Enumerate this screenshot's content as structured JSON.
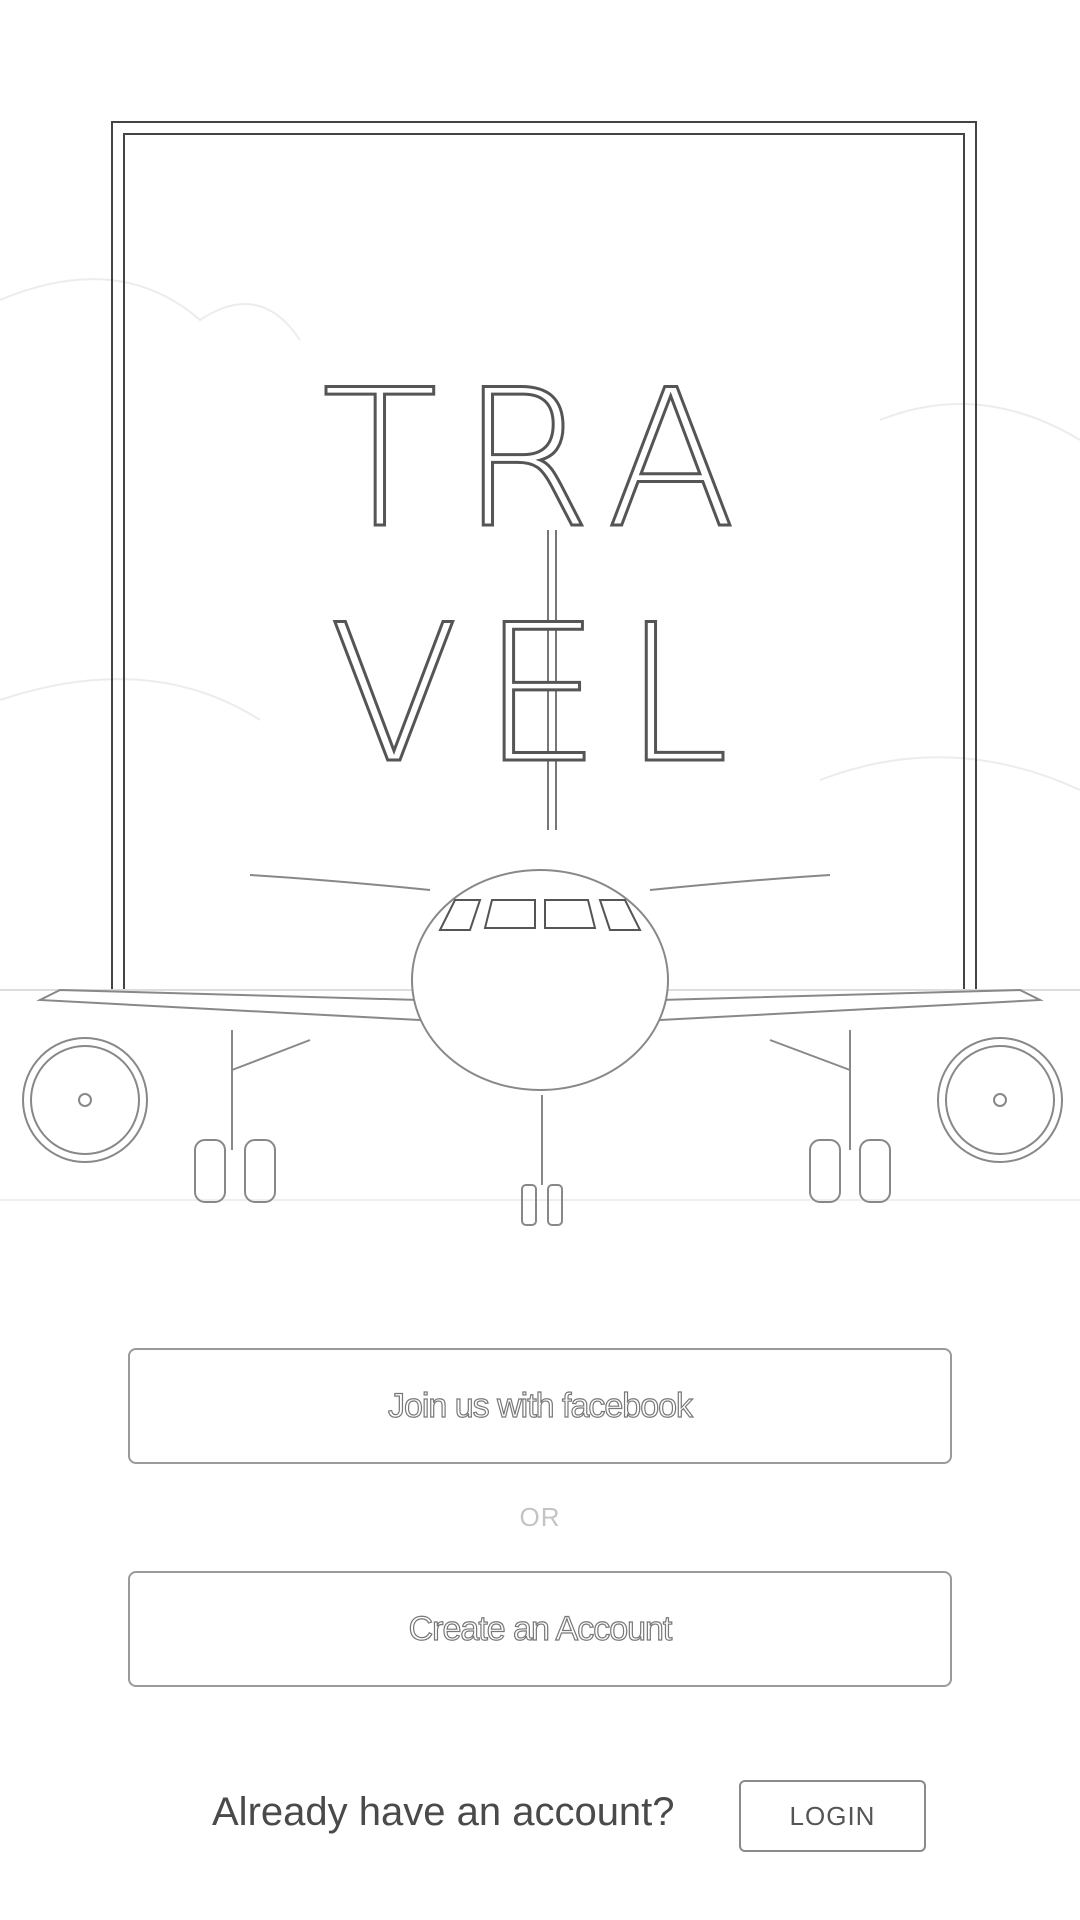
{
  "brand": {
    "line1": "TRA",
    "line2": "VEL"
  },
  "actions": {
    "facebook_label": "Join us with facebook",
    "or_label": "OR",
    "create_label": "Create an Account"
  },
  "footer": {
    "prompt": "Already have an account?",
    "login_label": "LOGIN"
  },
  "colors": {
    "background": "#ffffff",
    "outline": "#555555",
    "button_border": "#9a9a9a"
  }
}
